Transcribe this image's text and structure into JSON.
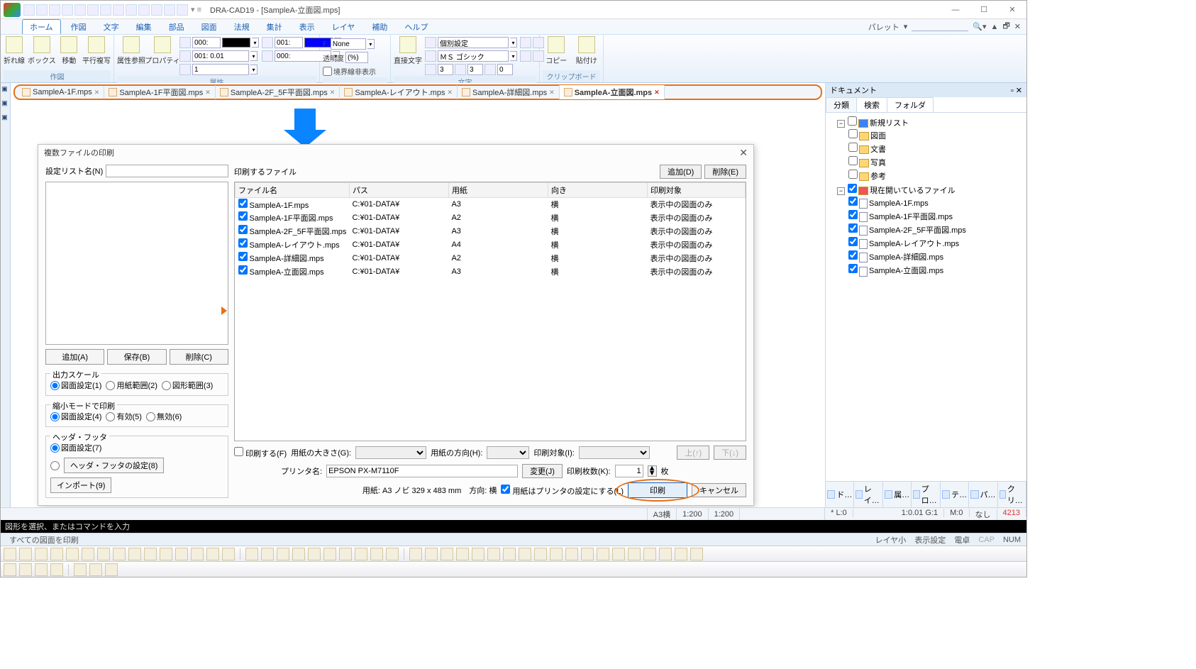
{
  "app": {
    "title": "DRA-CAD19 - [SampleA-立面図.mps]",
    "palette_label": "パレット"
  },
  "menu": {
    "tabs": [
      "ホーム",
      "作図",
      "文字",
      "編集",
      "部品",
      "図面",
      "法規",
      "集計",
      "表示",
      "レイヤ",
      "補助",
      "ヘルプ"
    ],
    "active": 0
  },
  "ribbon": {
    "g1": {
      "items": [
        "折れ線",
        "ボックス",
        "移動",
        "平行複写"
      ],
      "label": "作図"
    },
    "g2": {
      "items": [
        "属性参照",
        "プロパティ"
      ],
      "label": "属性",
      "rows": {
        "L": "000:",
        "C": "001:",
        "W": "001: 0.01",
        "M": "000:",
        "G": "1",
        "Lcolor": "#000000",
        "Ccolor": "#0000ff"
      }
    },
    "g3": {
      "F_label": "F:",
      "F_value": "None",
      "trans_label": "透明度",
      "trans_value": "(%)",
      "border_label": "境界線非表示"
    },
    "g4": {
      "items": [
        "直接文字"
      ],
      "font_label": "個別設定",
      "font_face": "ＭＳ ゴシック",
      "h": "3",
      "w": "3",
      "a": "0",
      "label": "文字"
    },
    "g5": {
      "items": [
        "コピー",
        "貼付け"
      ],
      "label": "クリップボード"
    }
  },
  "doctabs": [
    "SampleA-1F.mps",
    "SampleA-1F平面図.mps",
    "SampleA-2F_5F平面図.mps",
    "SampleA-レイアウト.mps",
    "SampleA-詳細図.mps",
    "SampleA-立面図.mps"
  ],
  "doctab_active": 5,
  "dialog": {
    "title": "複数ファイルの印刷",
    "setlist_label": "設定リスト名(N)",
    "left_buttons": [
      "追加(A)",
      "保存(B)",
      "削除(C)"
    ],
    "scale": {
      "title": "出力スケール",
      "opts": [
        "図面設定(1)",
        "用紙範囲(2)",
        "図形範囲(3)"
      ],
      "sel": 0
    },
    "shrink": {
      "title": "縮小モードで印刷",
      "opts": [
        "図面設定(4)",
        "有効(5)",
        "無効(6)"
      ],
      "sel": 0
    },
    "hf": {
      "title": "ヘッダ・フッタ",
      "opt": "図面設定(7)",
      "btn1": "ヘッダ・フッタの設定(8)",
      "btn2": "インポート(9)"
    },
    "right": {
      "label": "印刷するファイル",
      "add": "追加(D)",
      "del": "削除(E)",
      "headers": [
        "ファイル名",
        "パス",
        "用紙",
        "向き",
        "印刷対象"
      ],
      "rows": [
        {
          "f": "SampleA-1F.mps",
          "p": "C:¥01-DATA¥",
          "s": "A3",
          "o": "横",
          "t": "表示中の図面のみ"
        },
        {
          "f": "SampleA-1F平面図.mps",
          "p": "C:¥01-DATA¥",
          "s": "A2",
          "o": "横",
          "t": "表示中の図面のみ"
        },
        {
          "f": "SampleA-2F_5F平面図.mps",
          "p": "C:¥01-DATA¥",
          "s": "A3",
          "o": "横",
          "t": "表示中の図面のみ"
        },
        {
          "f": "SampleA-レイアウト.mps",
          "p": "C:¥01-DATA¥",
          "s": "A4",
          "o": "横",
          "t": "表示中の図面のみ"
        },
        {
          "f": "SampleA-詳細図.mps",
          "p": "C:¥01-DATA¥",
          "s": "A2",
          "o": "横",
          "t": "表示中の図面のみ"
        },
        {
          "f": "SampleA-立面図.mps",
          "p": "C:¥01-DATA¥",
          "s": "A3",
          "o": "横",
          "t": "表示中の図面のみ"
        }
      ],
      "print_f": "印刷する(F)",
      "papersize": "用紙の大きさ(G):",
      "orient": "用紙の方向(H):",
      "target": "印刷対象(I):",
      "up": "上(↑)",
      "down": "下(↓)",
      "printer_label": "プリンタ名:",
      "printer_value": "EPSON PX-M7110F",
      "change": "変更(J)",
      "copies_label": "印刷枚数(K):",
      "copies_value": "1",
      "copies_unit": "枚",
      "paperinfo": "用紙: A3 ノビ 329 x 483 mm　方向: 横",
      "useprinter": "用紙はプリンタの設定にする(L)",
      "print": "印刷",
      "cancel": "キャンセル"
    }
  },
  "docpanel": {
    "title": "ドキュメント",
    "tabs": [
      "分類",
      "検索",
      "フォルダ"
    ],
    "active": 0,
    "tree": {
      "newlist": "新規リスト",
      "cats": [
        "図面",
        "文書",
        "写真",
        "参考"
      ],
      "openfiles": "現在開いているファイル",
      "files": [
        "SampleA-1F.mps",
        "SampleA-1F平面図.mps",
        "SampleA-2F_5F平面図.mps",
        "SampleA-レイアウト.mps",
        "SampleA-詳細図.mps",
        "SampleA-立面図.mps"
      ]
    },
    "bottom": [
      "ド…",
      "レイ…",
      "属…",
      "プロ…",
      "テ…",
      "パ…",
      "クリ…"
    ]
  },
  "cmdbar": "図形を選択、またはコマンドを入力",
  "status": {
    "left": [
      "A3横",
      "1:200",
      "1:200"
    ],
    "right_items": [
      "* L:0",
      "1:0.01 G:1",
      "M:0",
      "なし",
      "4213"
    ]
  },
  "hint": {
    "left": "すべての図面を印刷",
    "items": [
      "レイヤ小",
      "表示設定",
      "電卓",
      "CAP",
      "NUM"
    ]
  }
}
